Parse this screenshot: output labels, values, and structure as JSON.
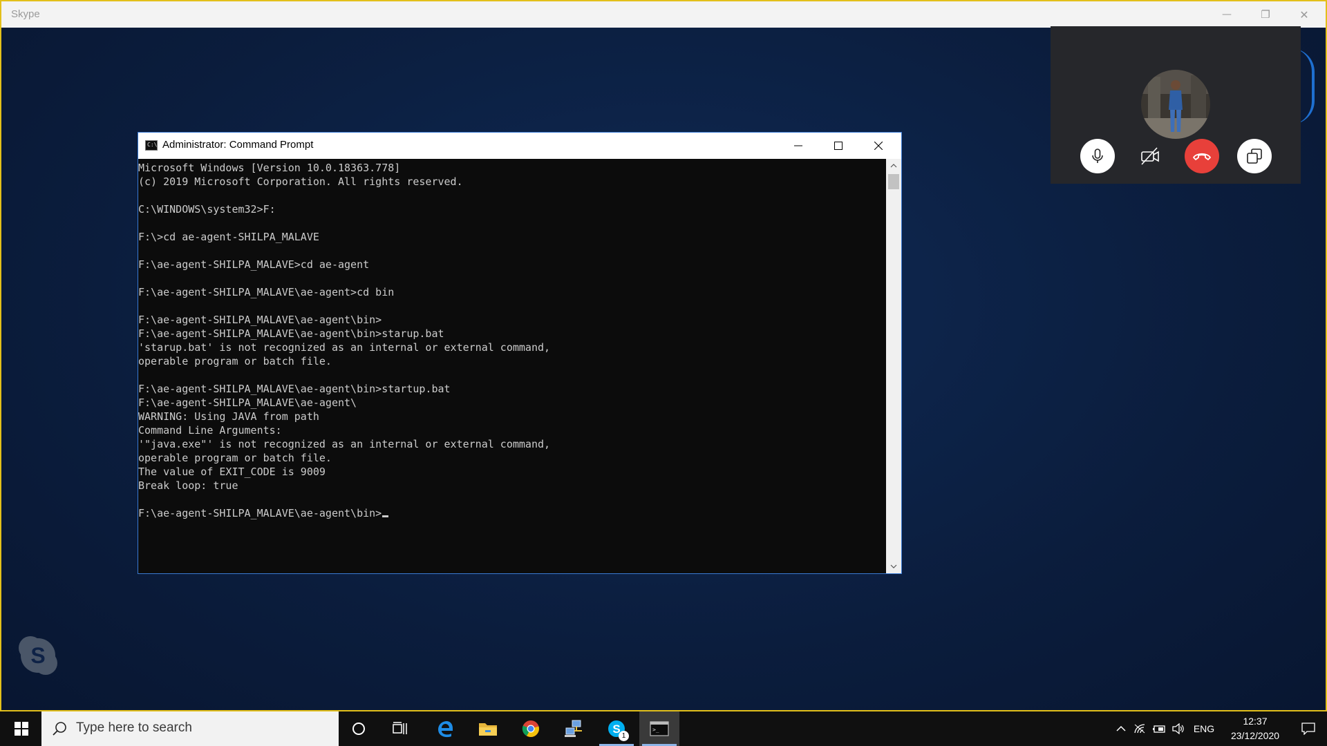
{
  "skype": {
    "title": "Skype",
    "window_controls": {
      "minimize": "—",
      "restore": "❐",
      "close": "✕"
    }
  },
  "call": {
    "caller_avatar_icon": "user-photo",
    "buttons": [
      "microphone-icon",
      "video-off-icon",
      "end-call-icon",
      "switch-view-icon"
    ],
    "end_call_color": "#e8403a"
  },
  "cmd": {
    "title": "Administrator: Command Prompt",
    "lines": [
      "Microsoft Windows [Version 10.0.18363.778]",
      "(c) 2019 Microsoft Corporation. All rights reserved.",
      "",
      "C:\\WINDOWS\\system32>F:",
      "",
      "F:\\>cd ae-agent-SHILPA_MALAVE",
      "",
      "F:\\ae-agent-SHILPA_MALAVE>cd ae-agent",
      "",
      "F:\\ae-agent-SHILPA_MALAVE\\ae-agent>cd bin",
      "",
      "F:\\ae-agent-SHILPA_MALAVE\\ae-agent\\bin>",
      "F:\\ae-agent-SHILPA_MALAVE\\ae-agent\\bin>starup.bat",
      "'starup.bat' is not recognized as an internal or external command,",
      "operable program or batch file.",
      "",
      "F:\\ae-agent-SHILPA_MALAVE\\ae-agent\\bin>startup.bat",
      "F:\\ae-agent-SHILPA_MALAVE\\ae-agent\\",
      "WARNING: Using JAVA from path",
      "Command Line Arguments:",
      "'\"java.exe\"' is not recognized as an internal or external command,",
      "operable program or batch file.",
      "The value of EXIT_CODE is 9009",
      "Break loop: true",
      ""
    ],
    "prompt": "F:\\ae-agent-SHILPA_MALAVE\\ae-agent\\bin>",
    "background": "#0c0c0c",
    "text_color": "#cccccc"
  },
  "taskbar": {
    "search_placeholder": "Type here to search",
    "pinned": [
      "windows-start",
      "cortana",
      "task-view",
      "edge",
      "file-explorer",
      "chrome",
      "network-app",
      "skype",
      "command-prompt"
    ],
    "skype_badge": "1",
    "language": "ENG",
    "time": "12:37",
    "date": "23/12/2020"
  },
  "colors": {
    "skype_border": "#e3c01a",
    "skype_blue": "#00aff0",
    "accent": "#3a7bd5"
  }
}
